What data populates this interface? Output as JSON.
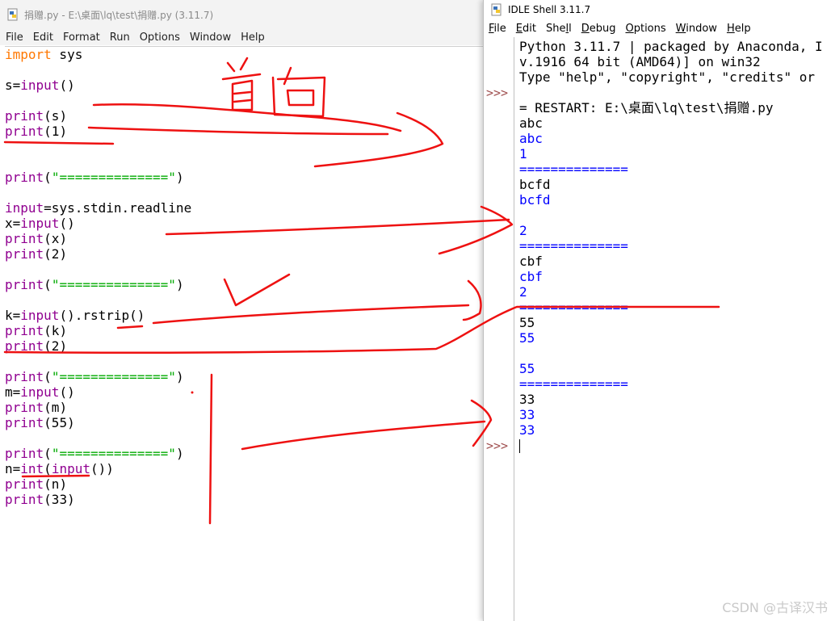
{
  "editor": {
    "title": "捐赠.py - E:\\桌面\\lq\\test\\捐赠.py (3.11.7)",
    "menu": [
      "File",
      "Edit",
      "Format",
      "Run",
      "Options",
      "Window",
      "Help"
    ],
    "code": [
      [
        {
          "t": "import",
          "c": "kw"
        },
        {
          "t": " sys",
          "c": ""
        }
      ],
      [],
      [
        {
          "t": "s=",
          "c": ""
        },
        {
          "t": "input",
          "c": "bi"
        },
        {
          "t": "()",
          "c": ""
        }
      ],
      [],
      [
        {
          "t": "print",
          "c": "bi"
        },
        {
          "t": "(s)",
          "c": ""
        }
      ],
      [
        {
          "t": "print",
          "c": "bi"
        },
        {
          "t": "(1)",
          "c": ""
        }
      ],
      [],
      [],
      [
        {
          "t": "print",
          "c": "bi"
        },
        {
          "t": "(",
          "c": ""
        },
        {
          "t": "\"==============\"",
          "c": "str"
        },
        {
          "t": ")",
          "c": ""
        }
      ],
      [],
      [
        {
          "t": "input",
          "c": "bi"
        },
        {
          "t": "=sys.stdin.readline",
          "c": ""
        }
      ],
      [
        {
          "t": "x=",
          "c": ""
        },
        {
          "t": "input",
          "c": "bi"
        },
        {
          "t": "()",
          "c": ""
        }
      ],
      [
        {
          "t": "print",
          "c": "bi"
        },
        {
          "t": "(x)",
          "c": ""
        }
      ],
      [
        {
          "t": "print",
          "c": "bi"
        },
        {
          "t": "(2)",
          "c": ""
        }
      ],
      [],
      [
        {
          "t": "print",
          "c": "bi"
        },
        {
          "t": "(",
          "c": ""
        },
        {
          "t": "\"==============\"",
          "c": "str"
        },
        {
          "t": ")",
          "c": ""
        }
      ],
      [],
      [
        {
          "t": "k=",
          "c": ""
        },
        {
          "t": "input",
          "c": "bi"
        },
        {
          "t": "().rstrip()",
          "c": ""
        }
      ],
      [
        {
          "t": "print",
          "c": "bi"
        },
        {
          "t": "(k)",
          "c": ""
        }
      ],
      [
        {
          "t": "print",
          "c": "bi"
        },
        {
          "t": "(2)",
          "c": ""
        }
      ],
      [],
      [
        {
          "t": "print",
          "c": "bi"
        },
        {
          "t": "(",
          "c": ""
        },
        {
          "t": "\"==============\"",
          "c": "str"
        },
        {
          "t": ")",
          "c": ""
        }
      ],
      [
        {
          "t": "m=",
          "c": ""
        },
        {
          "t": "input",
          "c": "bi"
        },
        {
          "t": "()",
          "c": ""
        }
      ],
      [
        {
          "t": "print",
          "c": "bi"
        },
        {
          "t": "(m)",
          "c": ""
        }
      ],
      [
        {
          "t": "print",
          "c": "bi"
        },
        {
          "t": "(55)",
          "c": ""
        }
      ],
      [],
      [
        {
          "t": "print",
          "c": "bi"
        },
        {
          "t": "(",
          "c": ""
        },
        {
          "t": "\"==============\"",
          "c": "str"
        },
        {
          "t": ")",
          "c": ""
        }
      ],
      [
        {
          "t": "n=",
          "c": ""
        },
        {
          "t": "int",
          "c": "bi"
        },
        {
          "t": "(",
          "c": ""
        },
        {
          "t": "input",
          "c": "bi"
        },
        {
          "t": "())",
          "c": ""
        }
      ],
      [
        {
          "t": "print",
          "c": "bi"
        },
        {
          "t": "(n)",
          "c": ""
        }
      ],
      [
        {
          "t": "print",
          "c": "bi"
        },
        {
          "t": "(33)",
          "c": ""
        }
      ]
    ]
  },
  "shell": {
    "title": "IDLE Shell 3.11.7",
    "menu": [
      {
        "label": "File",
        "ul": 0
      },
      {
        "label": "Edit",
        "ul": 0
      },
      {
        "label": "Shell",
        "ul": 3
      },
      {
        "label": "Debug",
        "ul": 0
      },
      {
        "label": "Options",
        "ul": 0
      },
      {
        "label": "Window",
        "ul": 0
      },
      {
        "label": "Help",
        "ul": 0
      }
    ],
    "prompt": ">>>",
    "lines": [
      {
        "text": "Python 3.11.7 | packaged by Anaconda, I",
        "color": "black"
      },
      {
        "text": "v.1916 64 bit (AMD64)] on win32",
        "color": "black"
      },
      {
        "text": "Type \"help\", \"copyright\", \"credits\" or",
        "color": "black"
      },
      {
        "text": "",
        "color": "black"
      },
      {
        "text": "= RESTART: E:\\桌面\\lq\\test\\捐赠.py",
        "color": "black"
      },
      {
        "text": "abc",
        "color": "black"
      },
      {
        "text": "abc",
        "color": "blue"
      },
      {
        "text": "1",
        "color": "blue"
      },
      {
        "text": "==============",
        "color": "blue"
      },
      {
        "text": "bcfd",
        "color": "black"
      },
      {
        "text": "bcfd",
        "color": "blue"
      },
      {
        "text": "",
        "color": "black"
      },
      {
        "text": "2",
        "color": "blue"
      },
      {
        "text": "==============",
        "color": "blue"
      },
      {
        "text": "cbf",
        "color": "black"
      },
      {
        "text": "cbf",
        "color": "blue"
      },
      {
        "text": "2",
        "color": "blue"
      },
      {
        "text": "==============",
        "color": "blue"
      },
      {
        "text": "55",
        "color": "black"
      },
      {
        "text": "55",
        "color": "blue"
      },
      {
        "text": "",
        "color": "black"
      },
      {
        "text": "55",
        "color": "blue"
      },
      {
        "text": "==============",
        "color": "blue"
      },
      {
        "text": "33",
        "color": "black"
      },
      {
        "text": "33",
        "color": "blue"
      },
      {
        "text": "33",
        "color": "blue"
      }
    ]
  },
  "watermark": "CSDN @古译汉书",
  "colors": {
    "keyword": "#ff7700",
    "builtin": "#900090",
    "string": "#00aa00",
    "output": "#0000ff",
    "annotation": "#ee1111"
  }
}
